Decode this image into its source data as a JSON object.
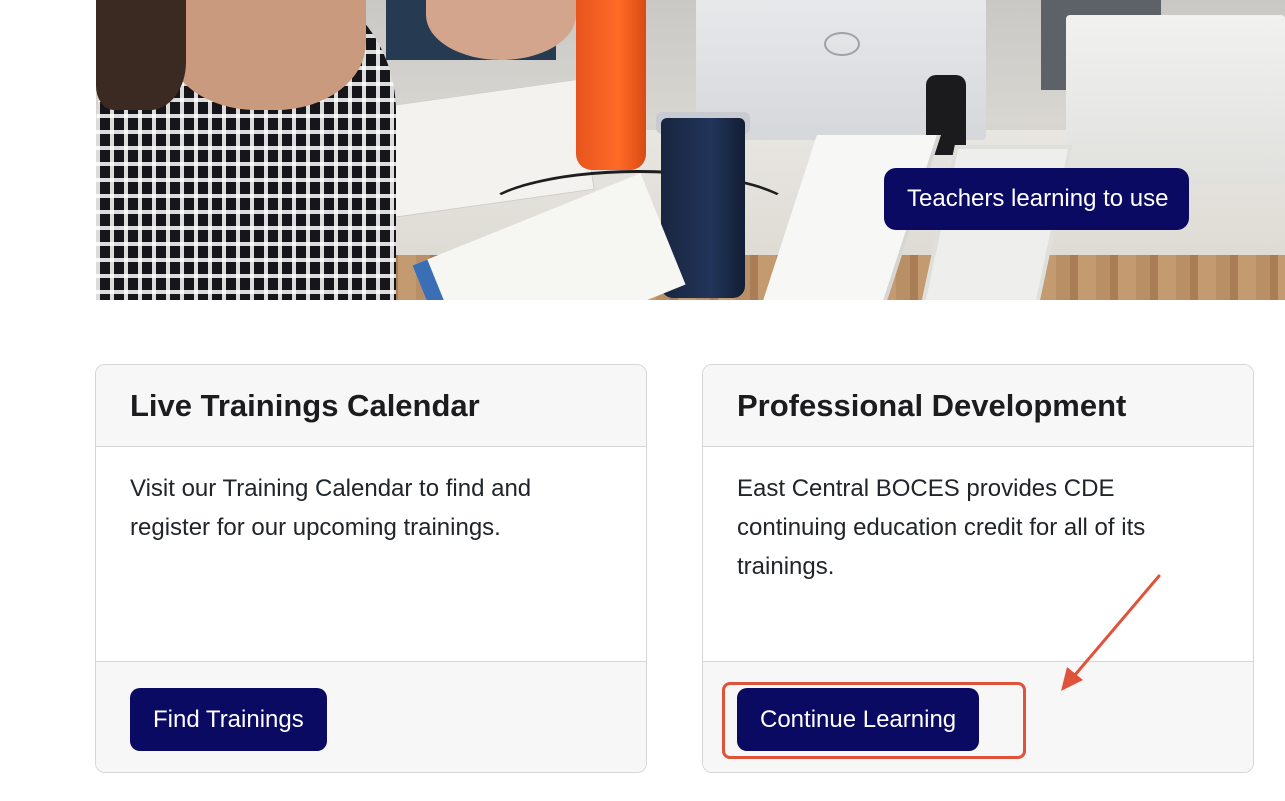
{
  "hero": {
    "caption": "Teachers learning to use"
  },
  "cards": [
    {
      "title": "Live Trainings Calendar",
      "text": "Visit our Training Calendar to find and register for our upcoming trainings.",
      "button_label": "Find Trainings"
    },
    {
      "title": "Professional Development",
      "text": "East Central BOCES provides CDE continuing education credit for all of its trainings.",
      "button_label": "Continue Learning"
    }
  ],
  "colors": {
    "brand_navy": "#0b0a63",
    "annotation_red": "#e0533b",
    "card_header_bg": "#f7f7f7",
    "card_border": "#d6d6d6"
  },
  "icons": {
    "annotation": "arrow-icon"
  }
}
